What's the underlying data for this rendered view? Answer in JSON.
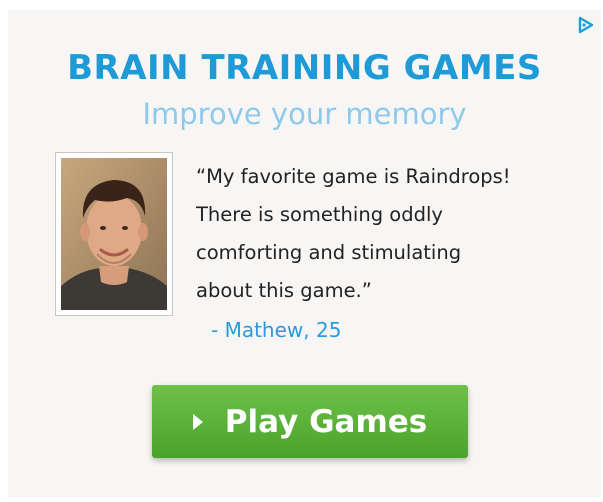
{
  "ad": {
    "title": "BRAIN TRAINING GAMES",
    "subtitle": "Improve your memory",
    "testimonial": {
      "lines": [
        "“My favorite game is Raindrops!",
        "There is something oddly",
        "comforting and stimulating",
        "about this game.”"
      ],
      "author": "- Mathew, 25"
    },
    "cta": {
      "label": "Play Games",
      "icon": "play-arrow-icon"
    },
    "adchoices_icon": "adchoices-icon"
  },
  "colors": {
    "title": "#1e9ad7",
    "subtitle": "#8fcaea",
    "author": "#2a9bd8",
    "cta_background": "#5bb33a",
    "cta_text": "#ffffff",
    "panel_background": "#f8f6f4"
  }
}
